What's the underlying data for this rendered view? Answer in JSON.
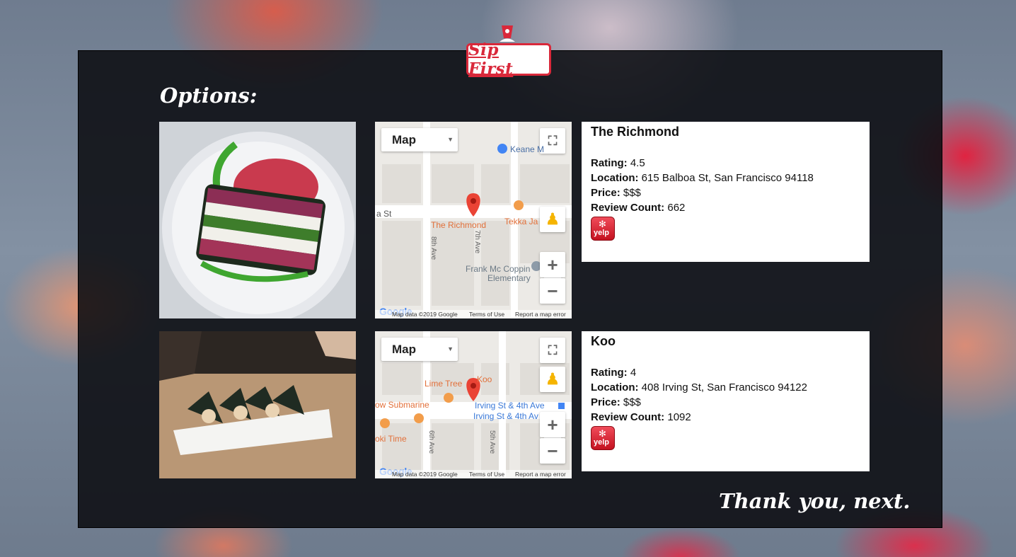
{
  "brand": {
    "name": "Sip First"
  },
  "options_heading": "Options:",
  "restaurants": [
    {
      "name": "The Richmond",
      "rating_label": "Rating:",
      "rating": "4.5",
      "location_label": "Location:",
      "location": "615 Balboa St, San Francisco 94118",
      "price_label": "Price:",
      "price": "$$$",
      "review_label": "Review Count:",
      "review_count": "662",
      "yelp_label": "yelp",
      "map": {
        "type_label": "Map",
        "labels": [
          "Keane M",
          "a St",
          "The Richmond",
          "Tekka Ja",
          "7th Ave",
          "8th Ave",
          "Frank Mc Coppin",
          "Elementary"
        ],
        "data_text": "Map data ©2019 Google",
        "terms": "Terms of Use",
        "report": "Report a map error",
        "google": "Google"
      }
    },
    {
      "name": "Koo",
      "rating_label": "Rating:",
      "rating": "4",
      "location_label": "Location:",
      "location": "408 Irving St, San Francisco 94122",
      "price_label": "Price:",
      "price": "$$$",
      "review_label": "Review Count:",
      "review_count": "1092",
      "yelp_label": "yelp",
      "map": {
        "type_label": "Map",
        "labels": [
          "Lime Tree",
          "Koo",
          "ow Submarine",
          "Irving St & 4th Ave",
          "Irving St & 4th Av",
          "oki Time",
          "6th Ave",
          "5th Ave"
        ],
        "data_text": "Map data ©2019 Google",
        "terms": "Terms of Use",
        "report": "Report a map error",
        "google": "Google"
      }
    }
  ],
  "next_button": "Thank you, next.",
  "colors": {
    "brand_red": "#d9283a",
    "panel": "#0a0c10",
    "yelp_red": "#d32323"
  }
}
